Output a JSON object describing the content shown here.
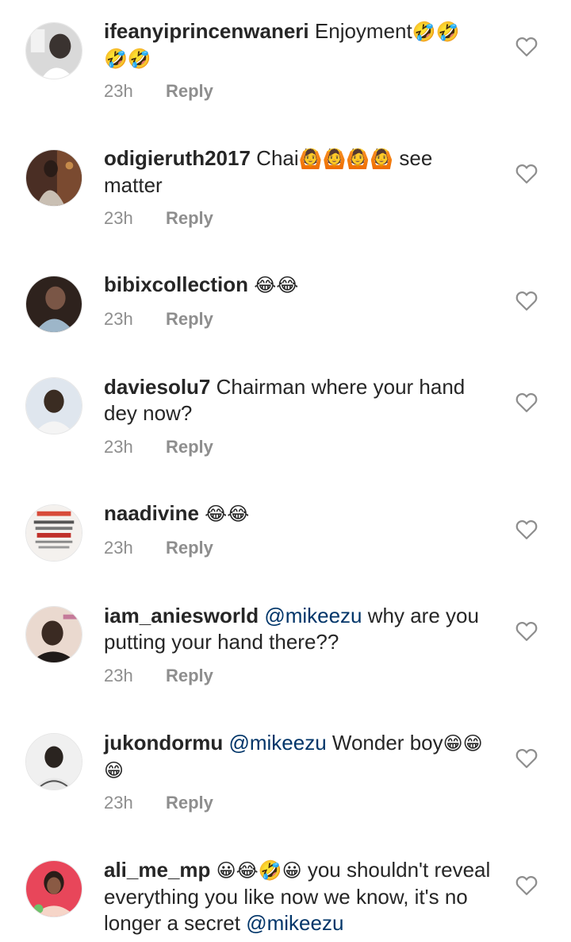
{
  "comments": [
    {
      "username": "ifeanyiprincenwaneri",
      "segments": [
        {
          "t": "Enjoyment"
        },
        {
          "t": "🤣🤣",
          "emoji": true
        },
        {
          "t": "🤣🤣",
          "emoji": true
        }
      ],
      "time": "23h",
      "reply_label": "Reply",
      "avatar_colors": [
        "#d7d7d7",
        "#3a3a3a"
      ]
    },
    {
      "username": "odigieruth2017",
      "segments": [
        {
          "t": "Chai"
        },
        {
          "t": "🙆🙆🙆🙆",
          "emoji": true
        },
        {
          "t": " see matter"
        }
      ],
      "time": "23h",
      "reply_label": "Reply",
      "avatar_colors": [
        "#6b3a2a",
        "#1f1a18"
      ]
    },
    {
      "username": "bibixcollection",
      "segments": [
        {
          "t": " "
        },
        {
          "t": "😂😂",
          "emoji": true
        }
      ],
      "time": "23h",
      "reply_label": "Reply",
      "avatar_colors": [
        "#3b2b25",
        "#8b6f5a"
      ]
    },
    {
      "username": "daviesolu7",
      "segments": [
        {
          "t": "Chairman where your hand dey now?"
        }
      ],
      "time": "23h",
      "reply_label": "Reply",
      "avatar_colors": [
        "#dfe6ee",
        "#2a2620"
      ]
    },
    {
      "username": "naadivine",
      "segments": [
        {
          "t": " "
        },
        {
          "t": "😂😂",
          "emoji": true
        }
      ],
      "time": "23h",
      "reply_label": "Reply",
      "avatar_colors": [
        "#f4f1ee",
        "#c0302a"
      ]
    },
    {
      "username": "iam_aniesworld",
      "segments": [
        {
          "t": "@mikeezu",
          "mention": true
        },
        {
          "t": " why are you putting your hand there??"
        }
      ],
      "time": "23h",
      "reply_label": "Reply",
      "avatar_colors": [
        "#e9d9cf",
        "#2c2320"
      ]
    },
    {
      "username": "jukondormu",
      "segments": [
        {
          "t": "@mikeezu",
          "mention": true
        },
        {
          "t": " Wonder boy"
        },
        {
          "t": "😁😁😁",
          "emoji": true
        }
      ],
      "time": "23h",
      "reply_label": "Reply",
      "avatar_colors": [
        "#f0f0f0",
        "#555555"
      ]
    },
    {
      "username": "ali_me_mp",
      "segments": [
        {
          "t": " "
        },
        {
          "t": "😀😂🤣😀",
          "emoji": true
        },
        {
          "t": " you shouldn't reveal everything you like now we know, it's no longer a secret "
        },
        {
          "t": "@mikeezu",
          "mention": true
        }
      ],
      "time": "",
      "reply_label": "",
      "avatar_colors": [
        "#e8465a",
        "#f6d5c8"
      ]
    }
  ],
  "icons": {
    "like": "heart-outline-icon"
  },
  "colors": {
    "text": "#262626",
    "muted": "#8e8e8e",
    "mention": "#003569",
    "icon": "#8e8e8e"
  }
}
